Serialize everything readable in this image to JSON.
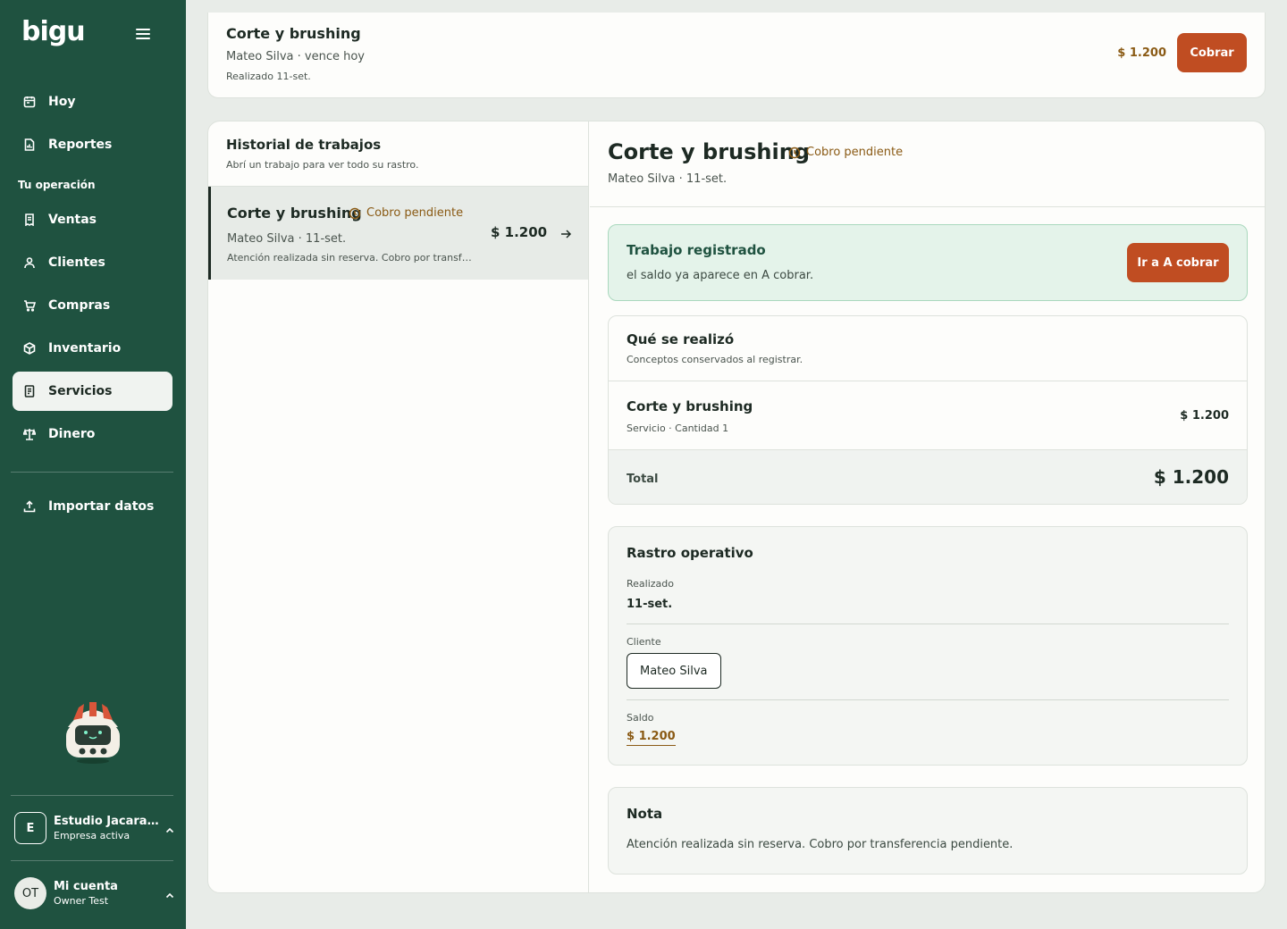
{
  "app": {
    "logo": "bigu"
  },
  "sidebar": {
    "items_top": [
      {
        "label": "Hoy",
        "icon": "calendar-icon"
      },
      {
        "label": "Reportes",
        "icon": "report-icon"
      }
    ],
    "section_label": "Tu operación",
    "items_ops": [
      {
        "label": "Ventas",
        "icon": "receipt-icon"
      },
      {
        "label": "Clientes",
        "icon": "user-icon"
      },
      {
        "label": "Compras",
        "icon": "cart-icon"
      },
      {
        "label": "Inventario",
        "icon": "box-icon"
      },
      {
        "label": "Servicios",
        "icon": "document-icon",
        "active": true
      },
      {
        "label": "Dinero",
        "icon": "scale-icon"
      }
    ],
    "import_label": "Importar datos",
    "company": {
      "initial": "E",
      "name": "Estudio Jacarandá",
      "status": "Empresa activa"
    },
    "account": {
      "initials": "OT",
      "title": "Mi cuenta",
      "user": "Owner Test"
    }
  },
  "top_card": {
    "title": "Corte y brushing",
    "subtitle": "Mateo Silva · vence hoy",
    "meta": "Realizado 11-set.",
    "amount": "$ 1.200",
    "button": "Cobrar"
  },
  "history": {
    "title": "Historial de trabajos",
    "subtitle": "Abrí un trabajo para ver todo su rastro.",
    "items": [
      {
        "title": "Corte y brushing",
        "badge": "Cobro pendiente",
        "subtitle": "Mateo Silva · 11-set.",
        "description": "Atención realizada sin reserva. Cobro por transferencia pendiente.",
        "amount": "$ 1.200"
      }
    ]
  },
  "detail": {
    "title": "Corte y brushing",
    "badge": "Cobro pendiente",
    "subtitle": "Mateo Silva · 11-set.",
    "alert": {
      "title": "Trabajo registrado",
      "text": "el saldo ya aparece en A cobrar.",
      "button": "Ir a A cobrar"
    },
    "concepts": {
      "title": "Qué se realizó",
      "subtitle": "Conceptos conservados al registrar.",
      "item_title": "Corte y brushing",
      "item_sub": "Servicio · Cantidad 1",
      "item_amount": "$ 1.200",
      "total_label": "Total",
      "total_amount": "$ 1.200"
    },
    "trace": {
      "title": "Rastro operativo",
      "realizado_label": "Realizado",
      "realizado_value": "11-set.",
      "cliente_label": "Cliente",
      "cliente_value": "Mateo Silva",
      "saldo_label": "Saldo",
      "saldo_value": "$ 1.200"
    },
    "note": {
      "title": "Nota",
      "text": "Atención realizada sin reserva. Cobro por transferencia pendiente."
    }
  },
  "colors": {
    "sidebar_bg": "#1f5240",
    "accent_orange": "#c04d22",
    "pending_amber": "#8a5a14",
    "success_bg": "#e4f3ea"
  }
}
